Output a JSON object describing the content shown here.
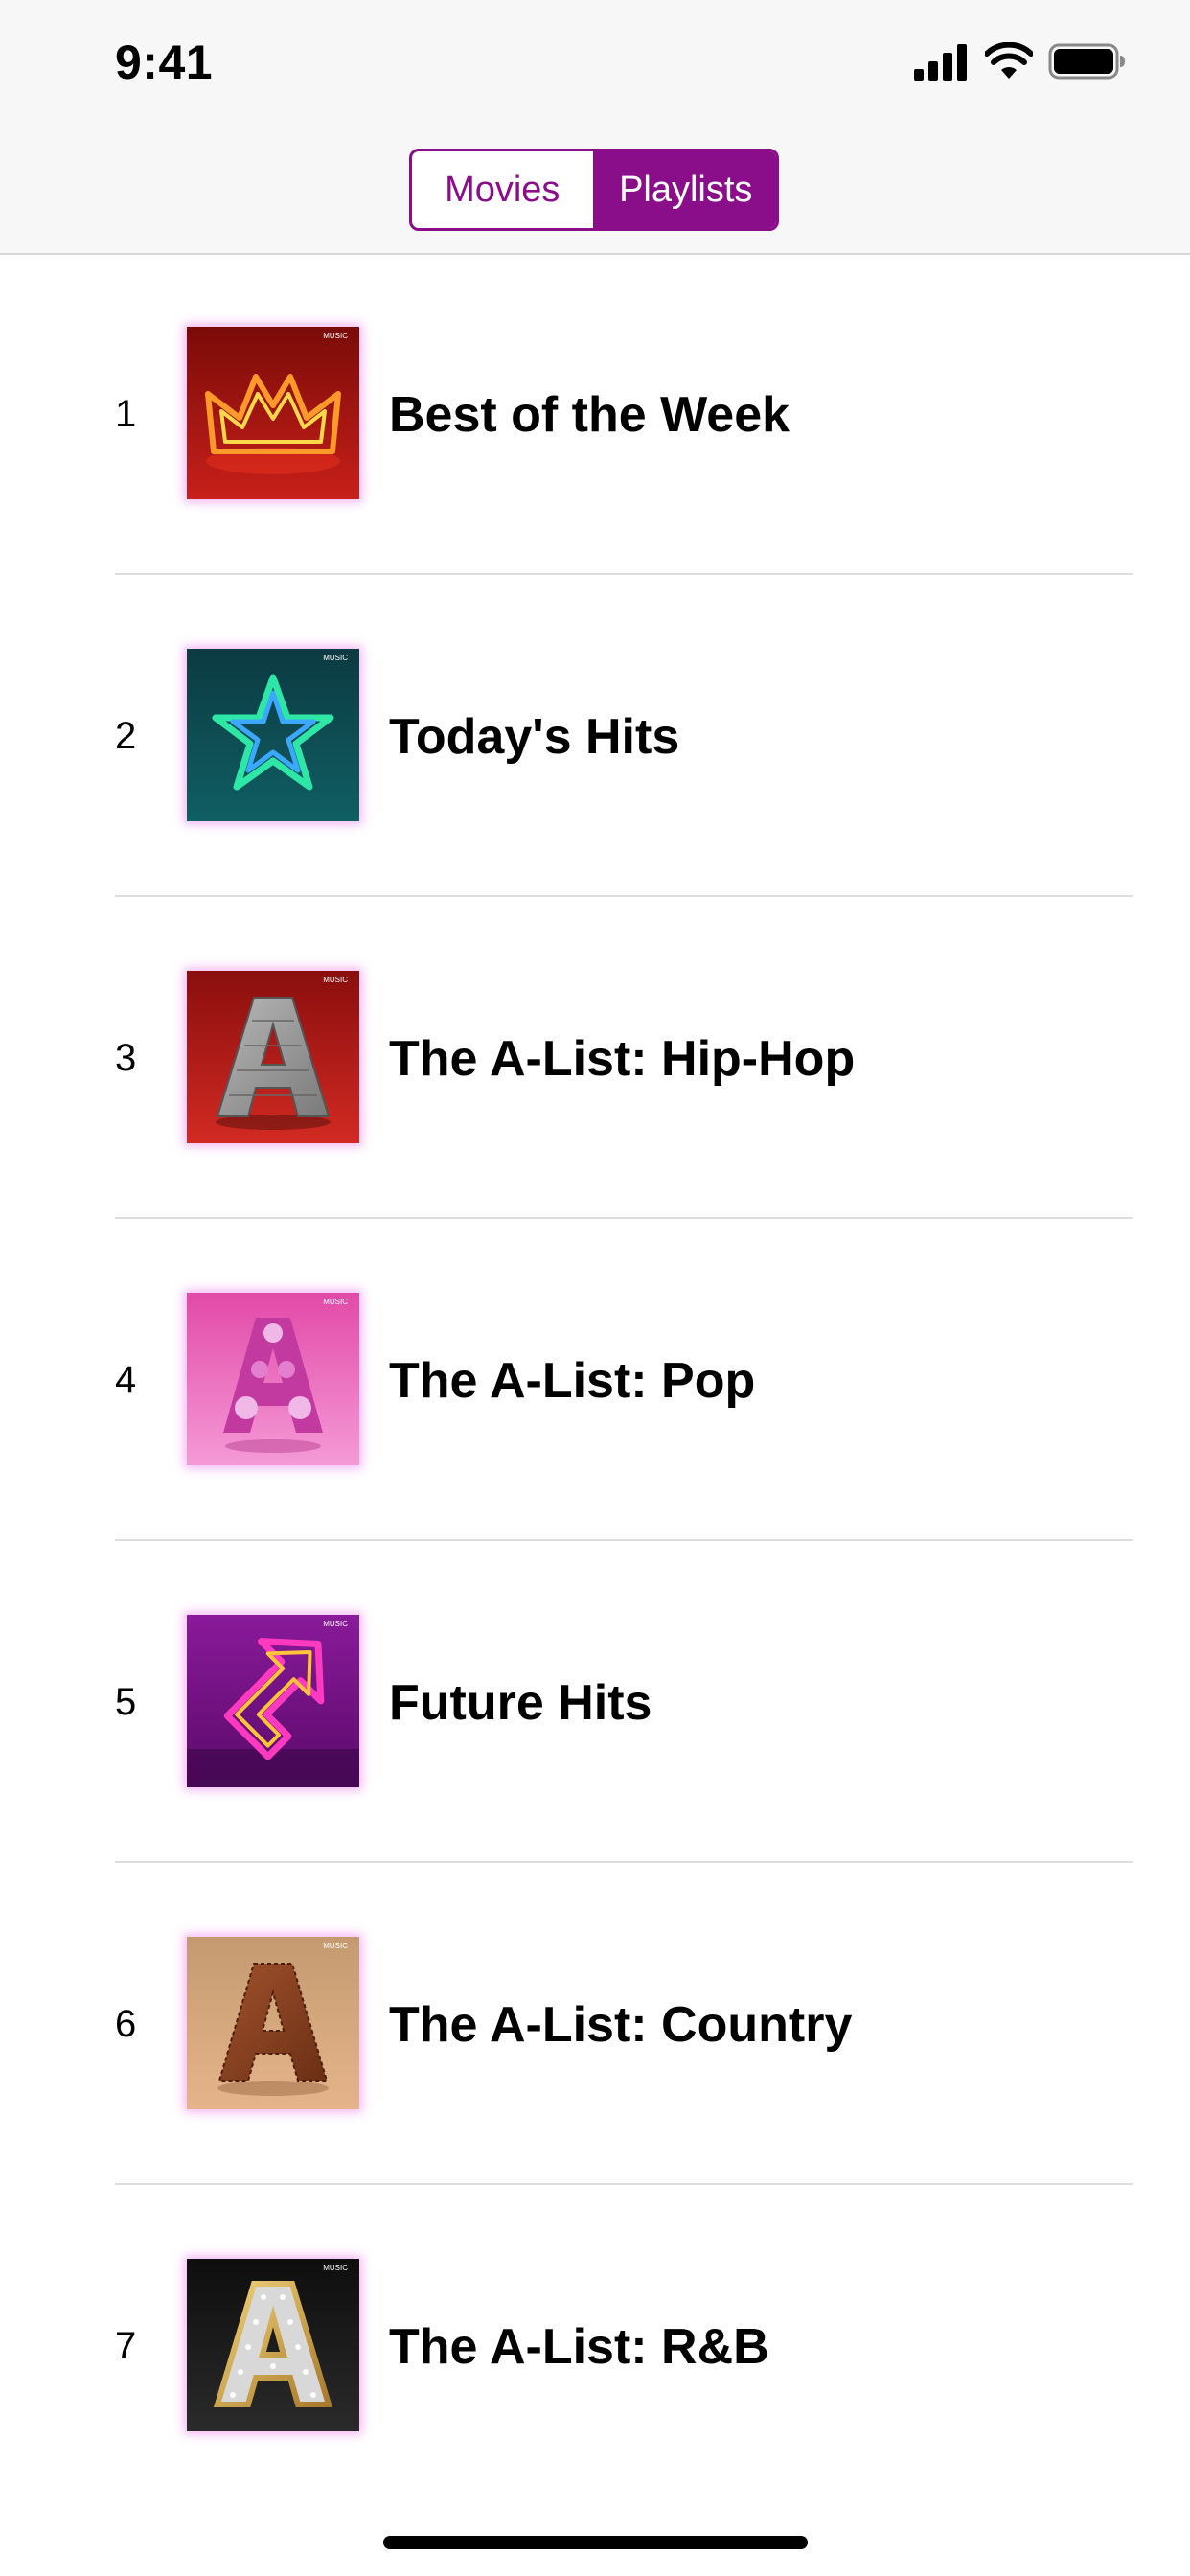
{
  "status_bar": {
    "time": "9:41"
  },
  "segmented_control": {
    "segments": [
      {
        "label": "Movies",
        "selected": false
      },
      {
        "label": "Playlists",
        "selected": true
      }
    ],
    "accent_color": "#8a0e8a"
  },
  "playlists": [
    {
      "rank": "1",
      "title": "Best of the Week",
      "artwork": "neon-crown"
    },
    {
      "rank": "2",
      "title": "Today's Hits",
      "artwork": "neon-star"
    },
    {
      "rank": "3",
      "title": "The A-List: Hip-Hop",
      "artwork": "brick-letter-a"
    },
    {
      "rank": "4",
      "title": "The A-List: Pop",
      "artwork": "pink-letter-a"
    },
    {
      "rank": "5",
      "title": "Future Hits",
      "artwork": "neon-arrow"
    },
    {
      "rank": "6",
      "title": "The A-List: Country",
      "artwork": "leather-letter-a"
    },
    {
      "rank": "7",
      "title": "The A-List: R&B",
      "artwork": "marquee-letter-a"
    }
  ],
  "artwork_badge": "MUSIC"
}
